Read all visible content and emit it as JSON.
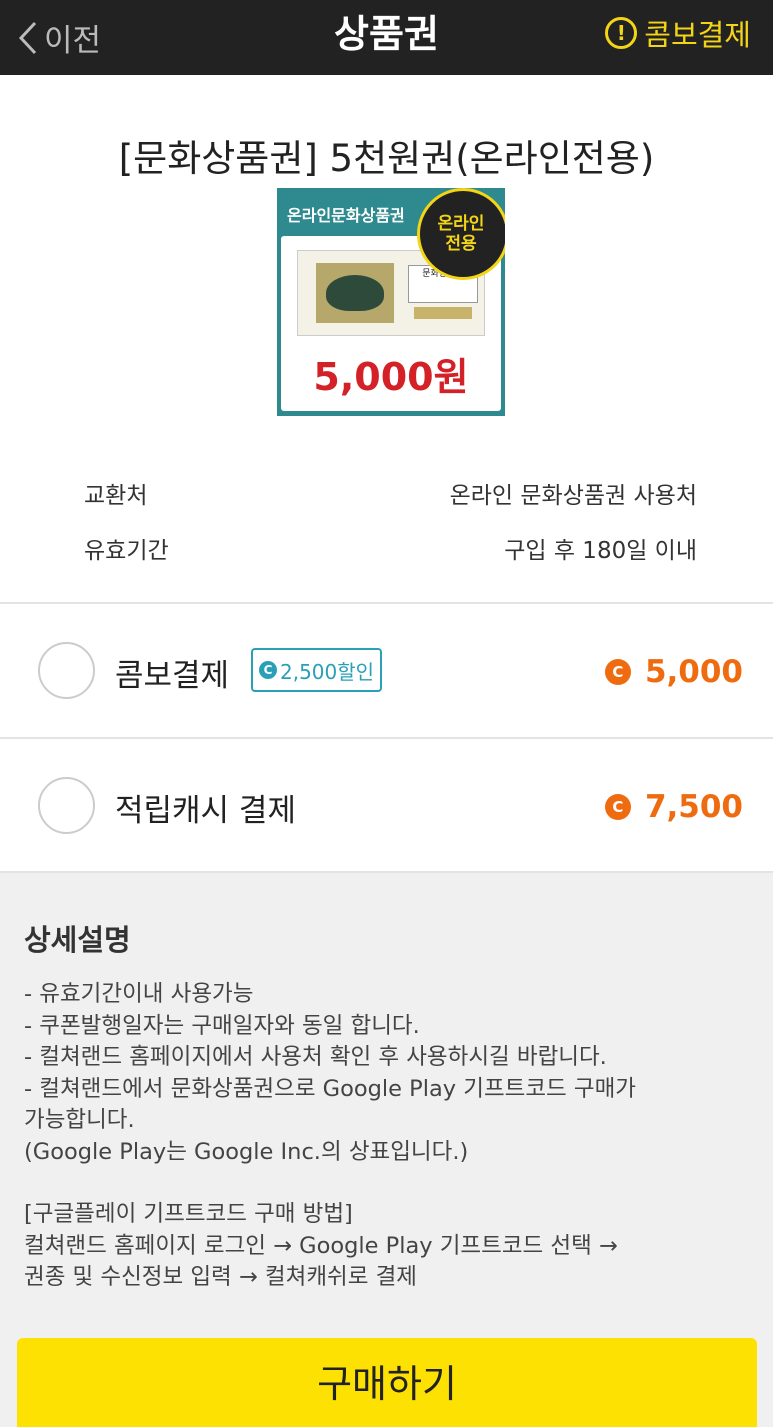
{
  "header": {
    "back_label": "이전",
    "title": "상품권",
    "combo_label": "콤보결제",
    "accent_color": "#f3d416"
  },
  "product": {
    "name": "[문화상품권] 5천원권(온라인전용)",
    "image": {
      "header_text": "온라인문화상품권",
      "badge_text": "온라인\n전용",
      "ticket_title": "문화상품권",
      "amount_text": "5,000원"
    }
  },
  "info": [
    {
      "label": "교환처",
      "value": "온라인 문화상품권 사용처"
    },
    {
      "label": "유효기간",
      "value": "구입 후 180일 이내"
    }
  ],
  "payment_options": [
    {
      "label": "콤보결제",
      "discount": "2,500할인",
      "price": "5,000",
      "selected": false
    },
    {
      "label": "적립캐시 결제",
      "price": "7,500",
      "selected": false
    }
  ],
  "detail": {
    "title": "상세설명",
    "lines": [
      "- 유효기간이내 사용가능",
      "- 쿠폰발행일자는 구매일자와 동일 합니다.",
      "- 컬쳐랜드 홈페이지에서 사용처 확인 후 사용하시길 바랍니다.",
      "- 컬쳐랜드에서 문화상품권으로 Google Play 기프트코드 구매가",
      "가능합니다.",
      "(Google Play는  Google Inc.의 상표입니다.)"
    ],
    "method_lines": [
      "[구글플레이 기프트코드 구매 방법]",
      "컬쳐랜드 홈페이지 로그인 → Google Play 기프트코드 선택 →",
      "권종 및 수신정보 입력 → 컬쳐캐쉬로 결제"
    ]
  },
  "buy_button": {
    "label": "구매하기",
    "color": "#fde102"
  },
  "colors": {
    "price": "#ef6b10",
    "discount": "#2aa0b8"
  }
}
